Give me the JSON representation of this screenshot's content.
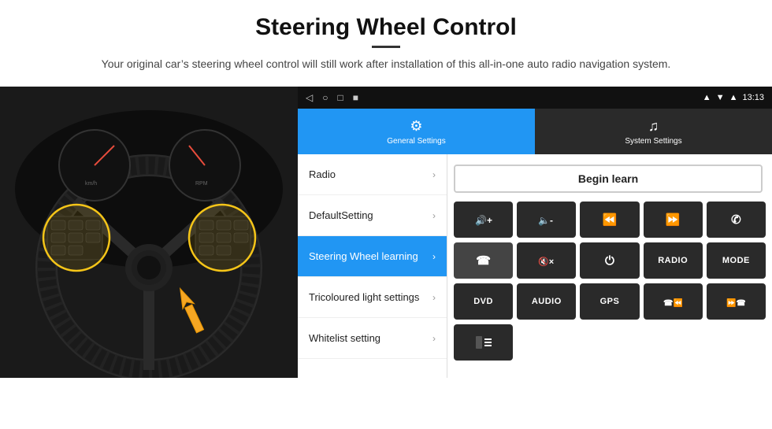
{
  "header": {
    "title": "Steering Wheel Control",
    "divider": true,
    "subtitle": "Your original car’s steering wheel control will still work after installation of this all-in-one auto radio navigation system."
  },
  "status_bar": {
    "nav_back": "◁",
    "nav_home": "○",
    "nav_recent": "□",
    "nav_extra": "■",
    "gps_icon": "⌂",
    "signal_icon": "▾",
    "wifi_icon": "▴",
    "time": "13:13"
  },
  "tabs": [
    {
      "id": "general",
      "label": "General Settings",
      "active": true
    },
    {
      "id": "system",
      "label": "System Settings",
      "active": false
    }
  ],
  "menu_items": [
    {
      "id": "radio",
      "label": "Radio",
      "active": false
    },
    {
      "id": "default",
      "label": "DefaultSetting",
      "active": false
    },
    {
      "id": "steering",
      "label": "Steering Wheel learning",
      "active": true
    },
    {
      "id": "tricoloured",
      "label": "Tricoloured light settings",
      "active": false
    },
    {
      "id": "whitelist",
      "label": "Whitelist setting",
      "active": false
    }
  ],
  "controls": {
    "begin_learn": "Begin learn",
    "row1": [
      {
        "icon": "🔊+",
        "label": "vol up",
        "type": "icon"
      },
      {
        "icon": "🔈-",
        "label": "vol down",
        "type": "icon"
      },
      {
        "icon": "⏮",
        "label": "prev track",
        "type": "icon"
      },
      {
        "icon": "⏭",
        "label": "next track",
        "type": "icon"
      },
      {
        "icon": "☎",
        "label": "phone",
        "type": "icon"
      }
    ],
    "row2": [
      {
        "icon": "✆",
        "label": "hang up",
        "type": "icon"
      },
      {
        "icon": "🔇×",
        "label": "mute",
        "type": "icon"
      },
      {
        "icon": "⏻",
        "label": "power",
        "type": "icon"
      },
      {
        "text": "RADIO",
        "label": "radio btn",
        "type": "text"
      },
      {
        "text": "MODE",
        "label": "mode btn",
        "type": "text"
      }
    ],
    "row3": [
      {
        "text": "DVD",
        "label": "dvd btn",
        "type": "text"
      },
      {
        "text": "AUDIO",
        "label": "audio btn",
        "type": "text"
      },
      {
        "text": "GPS",
        "label": "gps btn",
        "type": "text"
      },
      {
        "icon": "☎⏮",
        "label": "phone prev",
        "type": "icon"
      },
      {
        "icon": "⏭☎",
        "label": "phone next",
        "type": "icon"
      }
    ],
    "row4": [
      {
        "icon": "▐☰",
        "label": "menu icon",
        "type": "icon"
      }
    ]
  }
}
